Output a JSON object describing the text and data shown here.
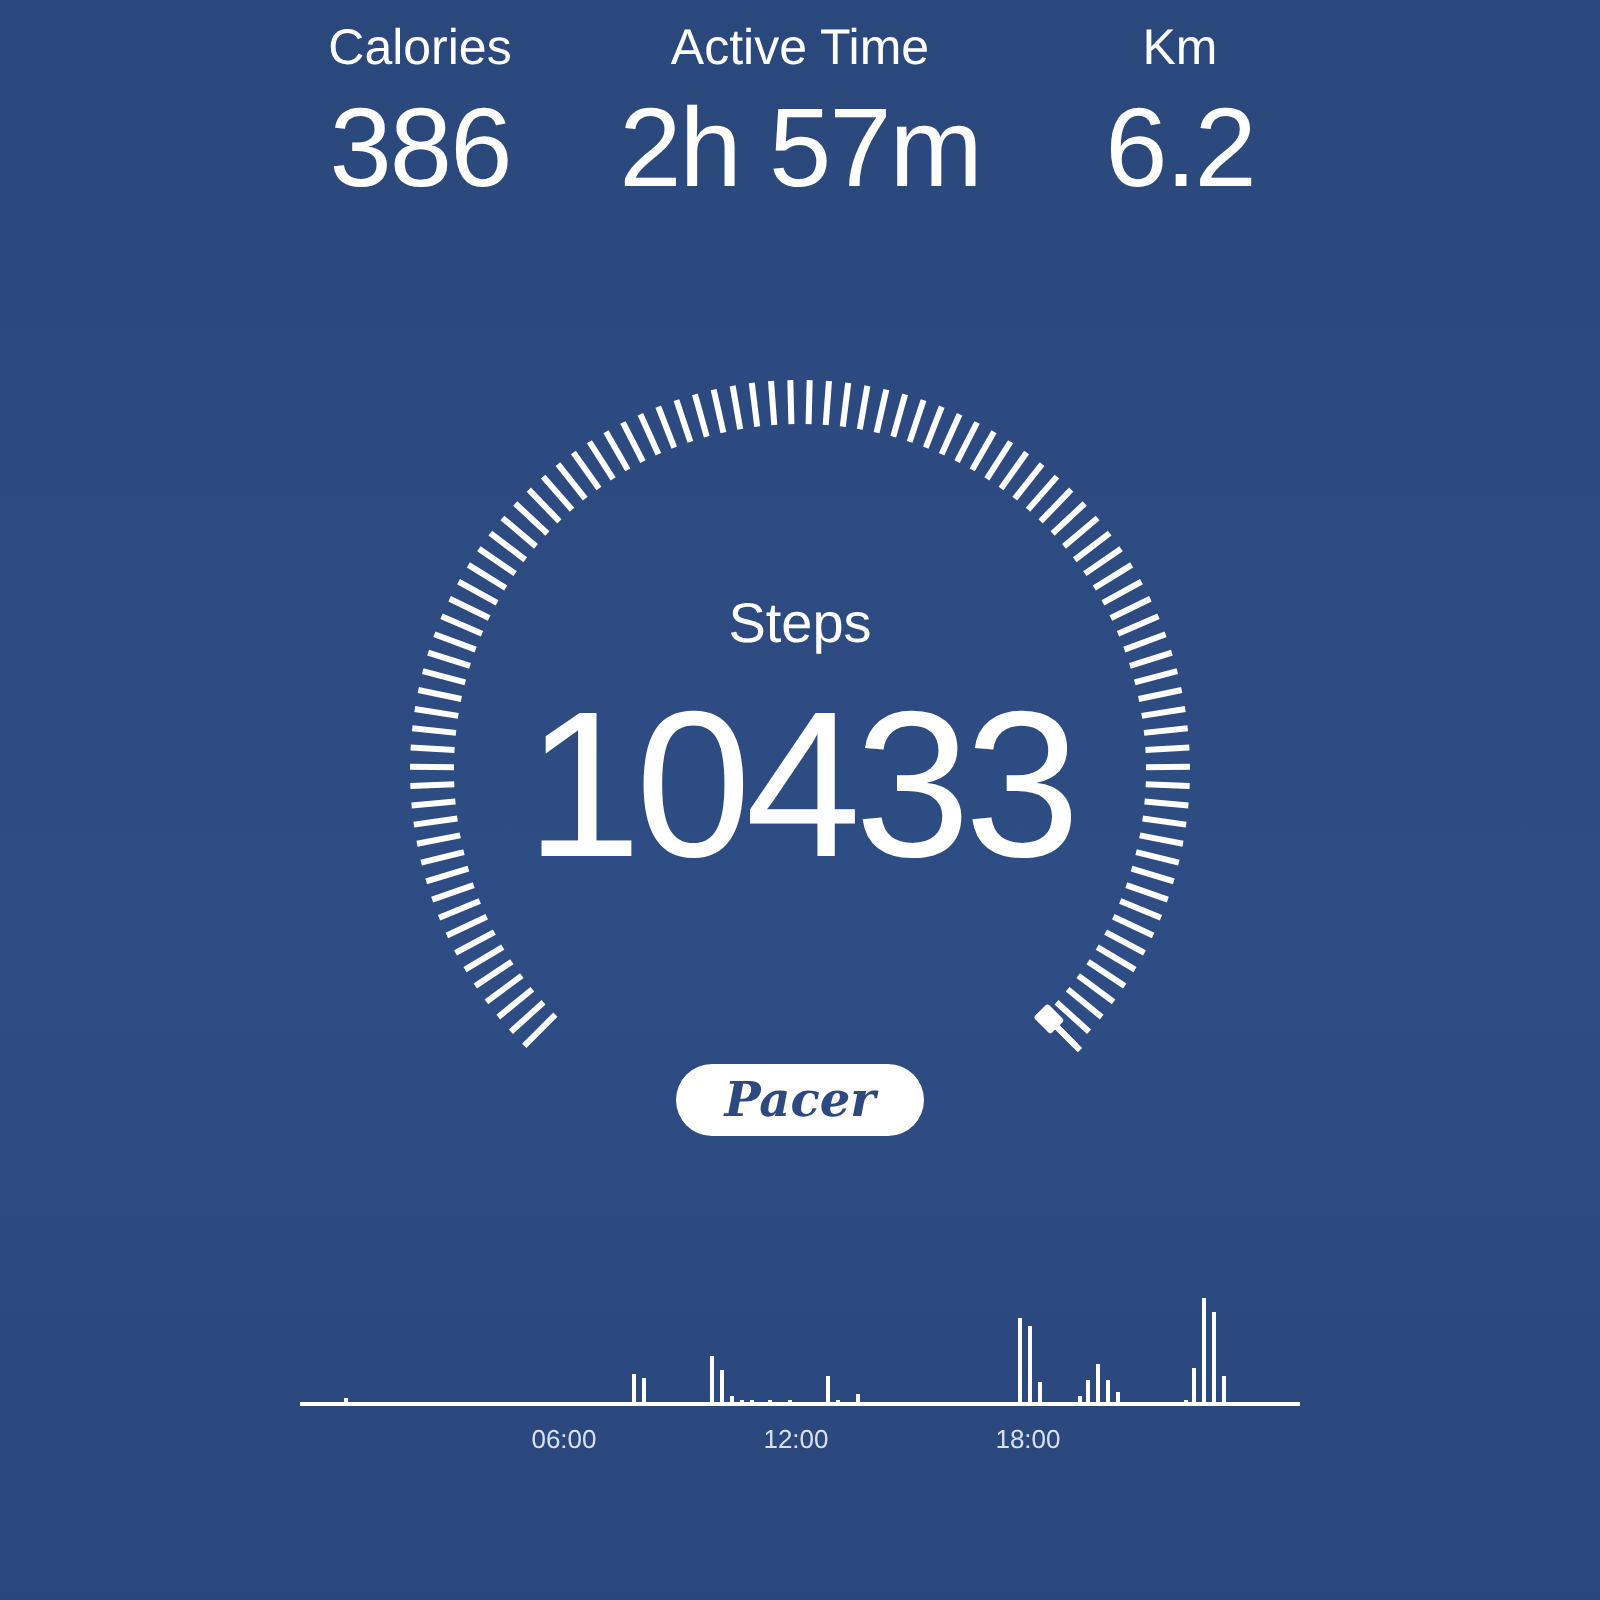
{
  "stats": [
    {
      "label": "Calories",
      "value": "386"
    },
    {
      "label": "Active Time",
      "value": "2h 57m"
    },
    {
      "label": "Km",
      "value": "6.2"
    }
  ],
  "gauge": {
    "label": "Steps",
    "value": "10433"
  },
  "brand": "Pacer",
  "chart": {
    "ticks": [
      "06:00",
      "12:00",
      "18:00"
    ]
  }
}
